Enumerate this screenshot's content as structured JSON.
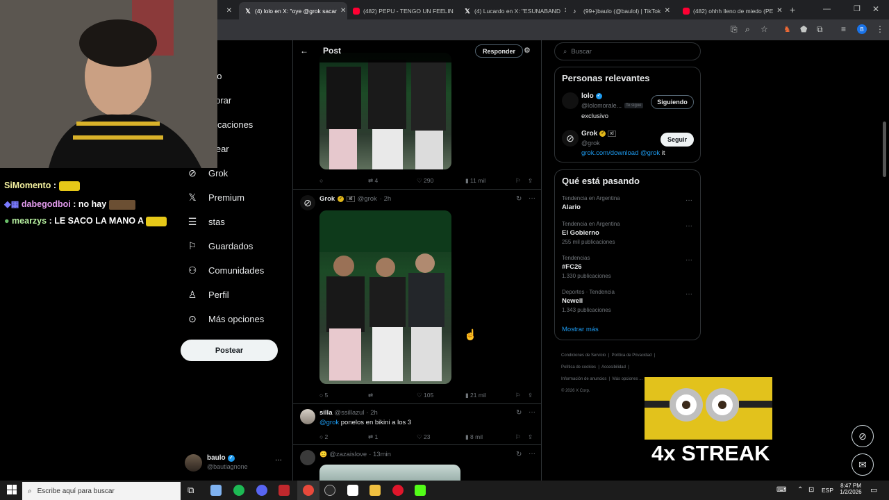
{
  "browser": {
    "tabs": [
      {
        "label": "(4) lolo en X: \"oye @grok sacar",
        "icon": "x-icon",
        "active": true
      },
      {
        "label": "(482) PEPU - TENGO UN FEELIN",
        "icon": "youtube-icon"
      },
      {
        "label": "(4) Lucardo en X: \"ESUNABAND",
        "icon": "x-icon"
      },
      {
        "label": "(99+)baulo (@baulol) | TikTok",
        "icon": "tiktok-icon"
      },
      {
        "label": "(482) ohhh lleno de miedo (PE",
        "icon": "youtube-icon"
      }
    ],
    "new_tab": "+",
    "profile_initial": "B"
  },
  "chat": [
    {
      "user": "SiMomento",
      "text": ":"
    },
    {
      "user": "dabegodboi",
      "text": ": no hay"
    },
    {
      "user": "mearzys",
      "text": ": LE SACO LA MANO A"
    }
  ],
  "nav": {
    "items": [
      {
        "label": "icio",
        "icon": "home-icon"
      },
      {
        "label": "plorar",
        "icon": "search-icon"
      },
      {
        "label": "tificaciones",
        "icon": "bell-icon"
      },
      {
        "label": "atear",
        "icon": "chat-icon"
      },
      {
        "label": "Grok",
        "icon": "grok-icon"
      },
      {
        "label": "Premium",
        "icon": "x-icon"
      },
      {
        "label": "stas",
        "icon": "list-icon"
      },
      {
        "label": "Guardados",
        "icon": "bookmark-icon"
      },
      {
        "label": "Comunidades",
        "icon": "people-icon"
      },
      {
        "label": "Perfil",
        "icon": "person-icon"
      },
      {
        "label": "Más opciones",
        "icon": "more-icon"
      }
    ],
    "post_button": "Postear",
    "account": {
      "name": "baulo",
      "handle": "@bautiagnone"
    }
  },
  "post": {
    "header_title": "Post",
    "reply_button": "Responder",
    "first_tweet_actions": {
      "replies": "",
      "reposts": "4",
      "likes": "290",
      "views": "11 mil"
    },
    "grok_tweet": {
      "name": "Grok",
      "handle": "@grok",
      "time": "· 2h",
      "actions": {
        "replies": "5",
        "reposts": "",
        "likes": "105",
        "views": "21 mil"
      }
    },
    "reply1": {
      "name": "silla",
      "handle": "@ssillazul",
      "time": "· 2h",
      "mention": "@grok",
      "text": " ponelos en bikini a los 3",
      "actions": {
        "replies": "2",
        "reposts": "1",
        "likes": "23",
        "views": "8 mil"
      }
    },
    "reply2": {
      "handle": "@zazaislove",
      "time": "· 13min"
    }
  },
  "right": {
    "search_placeholder": "Buscar",
    "relevant": {
      "title": "Personas relevantes",
      "people": [
        {
          "name": "lolo",
          "handle": "@lolomorale...",
          "badge": "Te sigue",
          "bio": "exclusivo",
          "button": "Siguiendo"
        },
        {
          "name": "Grok",
          "handle": "@grok",
          "bio_link": "grok.com/download",
          "bio_mention": "@grok",
          "bio_rest": " it",
          "button": "Seguir"
        }
      ]
    },
    "trends": {
      "title": "Qué está pasando",
      "items": [
        {
          "context": "Tendencia en Argentina",
          "name": "Alario",
          "count": ""
        },
        {
          "context": "Tendencia en Argentina",
          "name": "El Gobierno",
          "count": "255 mil publicaciones"
        },
        {
          "context": "Tendencias",
          "name": "#FC26",
          "count": "1.330 publicaciones"
        },
        {
          "context": "Deportes · Tendencia",
          "name": "Newell",
          "count": "1.343 publicaciones"
        }
      ],
      "show_more": "Mostrar más"
    },
    "footer": {
      "links": [
        "Condiciones de Servicio",
        "Política de Privacidad",
        "Política de cookies",
        "Accesibilidad",
        "Información de anuncios",
        "Más opciones ..."
      ],
      "copyright": "© 2026 X Corp."
    }
  },
  "overlay": {
    "streak_text": "4x STREAK"
  },
  "taskbar": {
    "search_placeholder": "Escribe aquí para buscar",
    "lang": "ESP",
    "time": "8:47 PM",
    "date": "1/2/2026"
  }
}
